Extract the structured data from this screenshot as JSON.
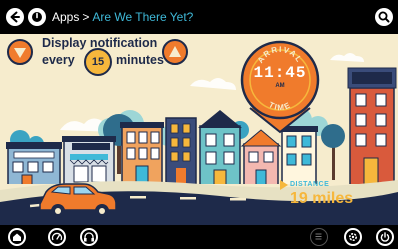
{
  "nav": {
    "breadcrumb_root": "Apps",
    "breadcrumb_separator": ">",
    "breadcrumb_current": "Are We There Yet?"
  },
  "notification": {
    "line1": "Display notification",
    "every_label": "every",
    "interval_value": "15",
    "minutes_label": "minutes"
  },
  "arrival": {
    "title": "ARRIVAL",
    "title_bottom": "TIME",
    "time": "11:45",
    "ampm": "AM"
  },
  "distance": {
    "label": "DISTANCE",
    "value": "19 miles"
  },
  "signs": {
    "shop_sign": "CUPCAKES",
    "left_sign": "FOR SALE",
    "right_top_sign": "OPEN",
    "right_clock": "00:15 am"
  },
  "colors": {
    "accent_orange": "#f07b2c",
    "accent_yellow": "#f6b73c",
    "navy": "#1e2a4a",
    "teal": "#3fb9d8",
    "background": "#f6eccd"
  },
  "icons": {
    "back": "back-arrow-icon",
    "apps": "apps-icon",
    "search": "search-icon",
    "home": "home-icon",
    "dashboard": "speedometer-icon",
    "audio": "headphones-icon",
    "menu": "menu-icon",
    "settings": "gear-icon",
    "power": "power-icon",
    "decrease": "triangle-down-icon",
    "increase": "triangle-up-icon"
  }
}
